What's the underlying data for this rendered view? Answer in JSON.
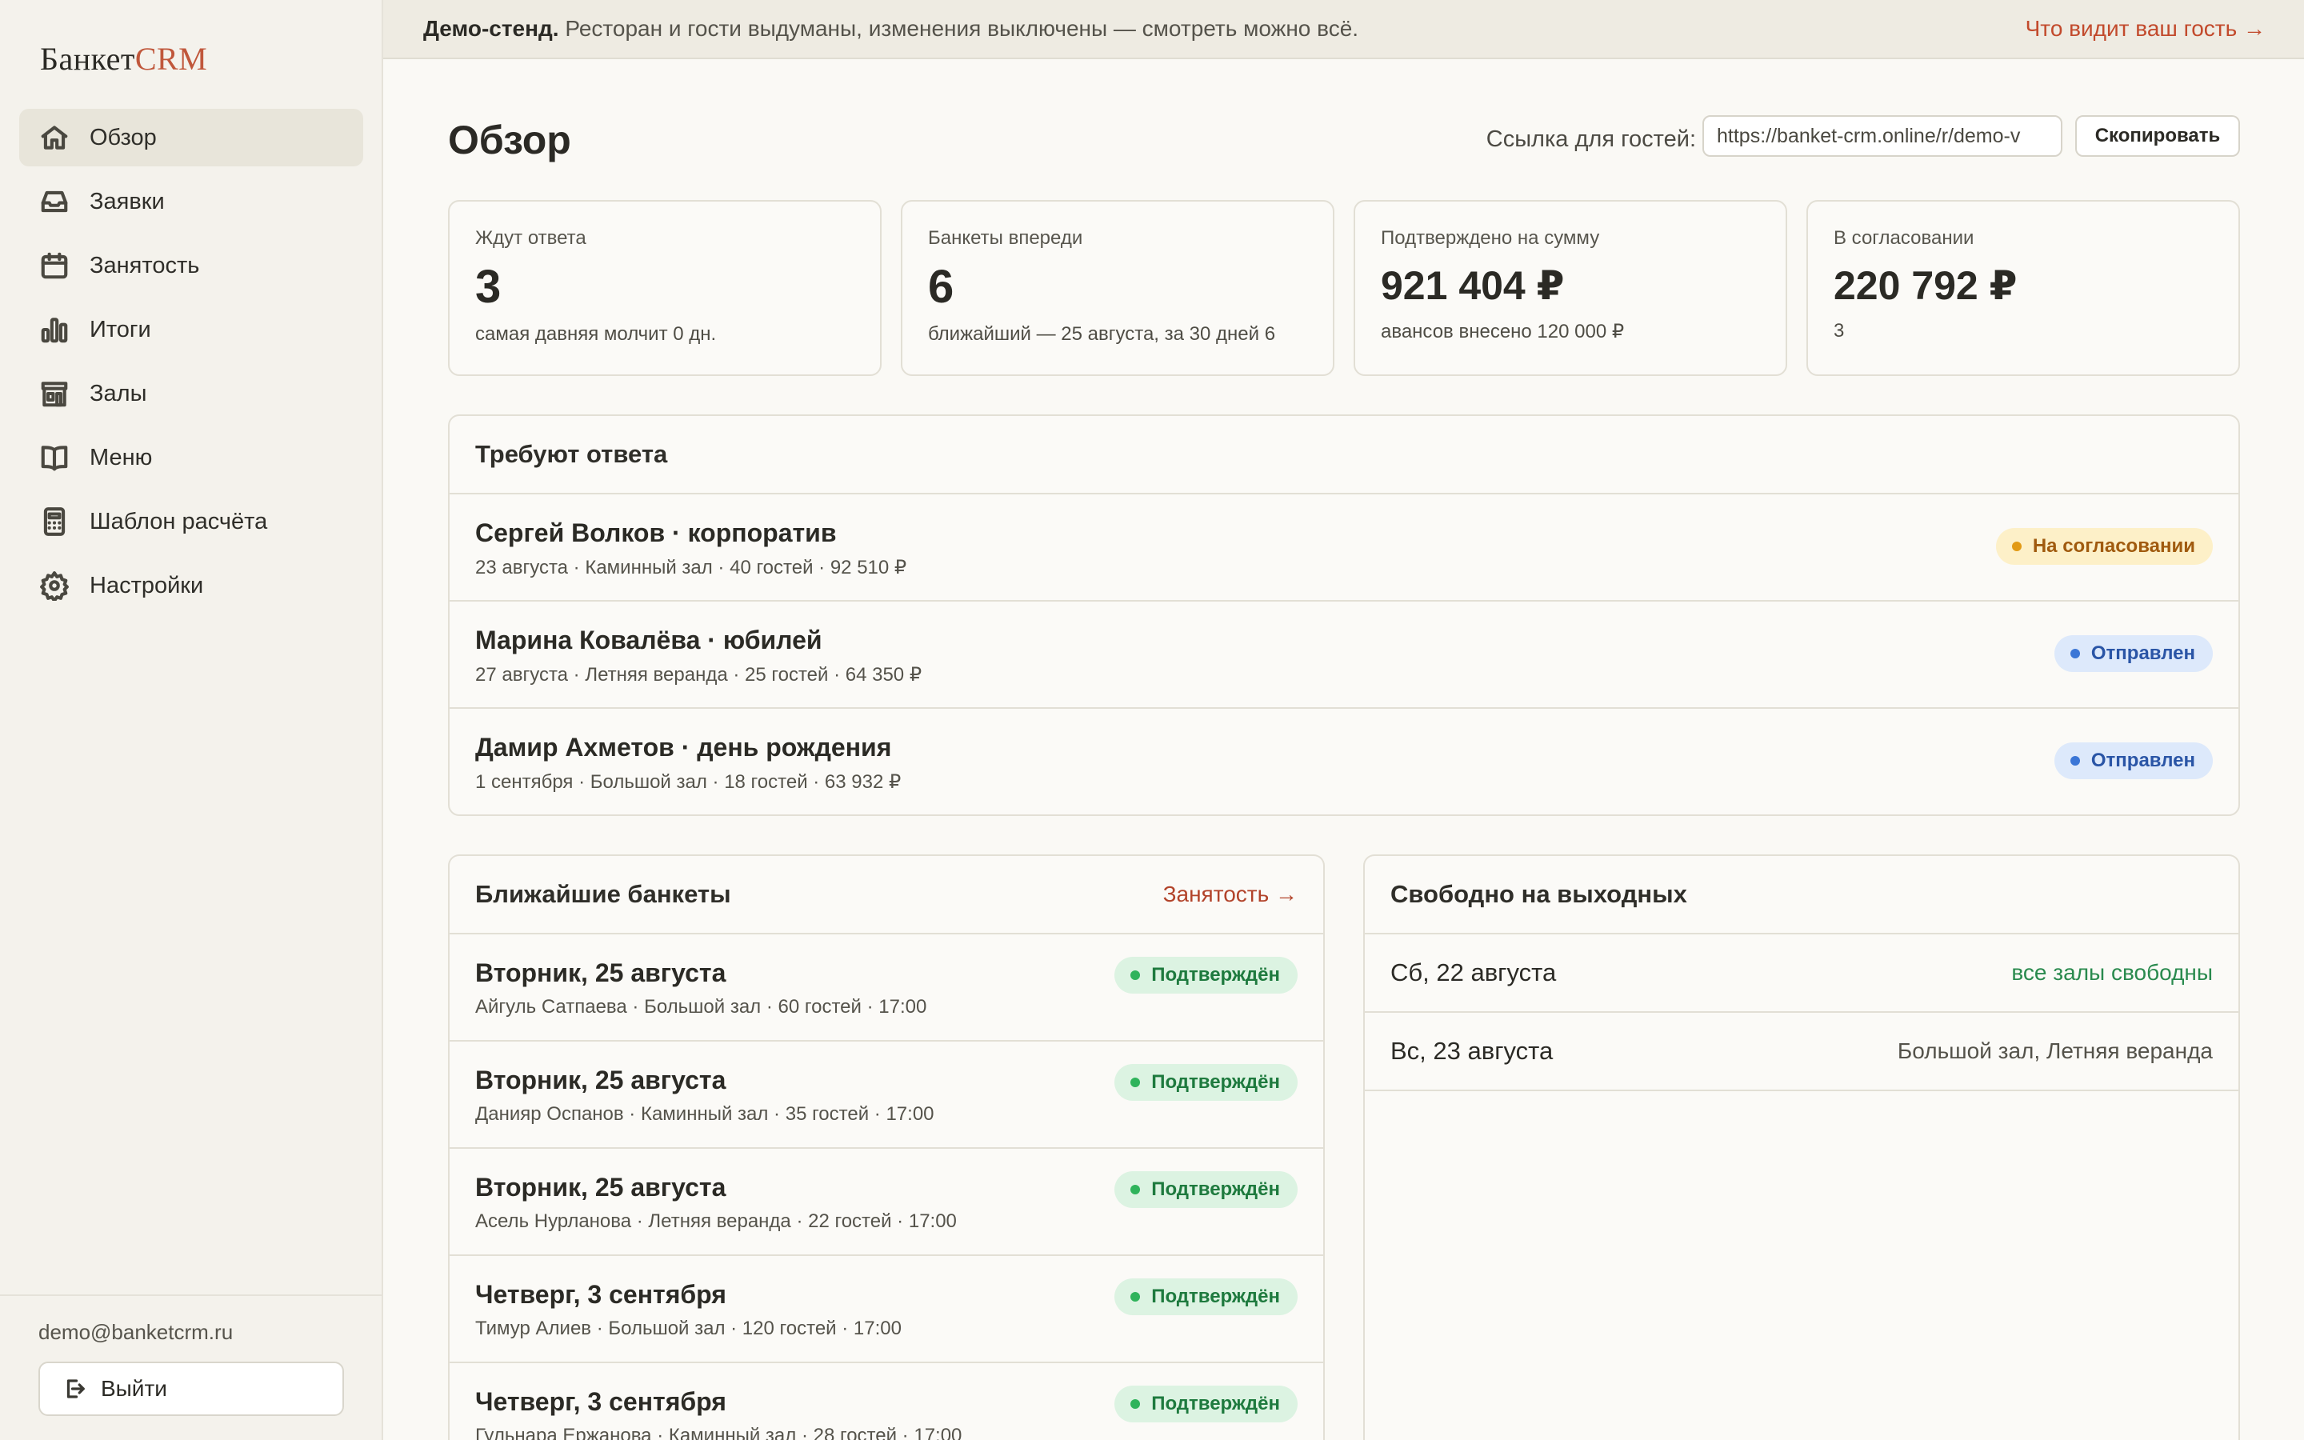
{
  "sidebar": {
    "logo_part1": "Банкет",
    "logo_part2": "CRM",
    "items": [
      {
        "label": "Обзор",
        "icon": "home-icon",
        "active": true
      },
      {
        "label": "Заявки",
        "icon": "inbox-icon"
      },
      {
        "label": "Занятость",
        "icon": "calendar-icon"
      },
      {
        "label": "Итоги",
        "icon": "bar-chart-icon"
      },
      {
        "label": "Залы",
        "icon": "store-icon"
      },
      {
        "label": "Меню",
        "icon": "book-icon"
      },
      {
        "label": "Шаблон расчёта",
        "icon": "calculator-icon"
      },
      {
        "label": "Настройки",
        "icon": "gear-icon"
      }
    ],
    "user_email": "demo@banketcrm.ru",
    "logout_label": "Выйти"
  },
  "banner": {
    "strong": "Демо-стенд.",
    "text": "Ресторан и гости выдуманы, изменения выключены — смотреть можно всё.",
    "link": "Что видит ваш гость →"
  },
  "header": {
    "title": "Обзор",
    "guest_link_label": "Ссылка для гостей:",
    "guest_link_value": "https://banket-crm.online/r/demo-v",
    "copy_label": "Скопировать"
  },
  "stats": [
    {
      "label": "Ждут ответа",
      "value": "3",
      "sub": "самая давняя молчит 0 дн."
    },
    {
      "label": "Банкеты впереди",
      "value": "6",
      "sub": "ближайший — 25 августа, за 30 дней 6"
    },
    {
      "label": "Подтверждено на сумму",
      "value": "921 404 ₽",
      "sub": "авансов внесено 120 000 ₽"
    },
    {
      "label": "В согласовании",
      "value": "220 792 ₽",
      "sub": "3"
    }
  ],
  "requests": {
    "title": "Требуют ответа",
    "rows": [
      {
        "title": "Сергей Волков · корпоратив",
        "sub": "23 августа · Каминный зал · 40 гостей · 92 510 ₽",
        "status": "На согласовании"
      },
      {
        "title": "Марина Ковалёва · юбилей",
        "sub": "27 августа · Летняя веранда · 25 гостей · 64 350 ₽",
        "status": "Отправлен"
      },
      {
        "title": "Дамир Ахметов · день рождения",
        "sub": "1 сентября · Большой зал · 18 гостей · 63 932 ₽",
        "status": "Отправлен"
      }
    ]
  },
  "upcoming": {
    "title": "Ближайшие банкеты",
    "link": "Занятость →",
    "rows": [
      {
        "title": "Вторник, 25 августа",
        "sub": "Айгуль Сатпаева · Большой зал · 60 гостей · 17:00",
        "status": "Подтверждён"
      },
      {
        "title": "Вторник, 25 августа",
        "sub": "Данияр Оспанов · Каминный зал · 35 гостей · 17:00",
        "status": "Подтверждён"
      },
      {
        "title": "Вторник, 25 августа",
        "sub": "Асель Нурланова · Летняя веранда · 22 гостей · 17:00",
        "status": "Подтверждён"
      },
      {
        "title": "Четверг, 3 сентября",
        "sub": "Тимур Алиев · Большой зал · 120 гостей · 17:00",
        "status": "Подтверждён"
      },
      {
        "title": "Четверг, 3 сентября",
        "sub": "Гульнара Ержанова · Каминный зал · 28 гостей · 17:00",
        "status": "Подтверждён"
      }
    ]
  },
  "weekend": {
    "title": "Свободно на выходных",
    "rows": [
      {
        "day": "Сб, 22 августа",
        "status": "все залы свободны"
      },
      {
        "day": "Вс, 23 августа",
        "status": "Большой зал, Летняя веранда"
      }
    ]
  },
  "colors": {
    "accent": "#c0573b",
    "pending": "#e29a15",
    "sent": "#3b76d6",
    "confirmed": "#2fb35b"
  }
}
